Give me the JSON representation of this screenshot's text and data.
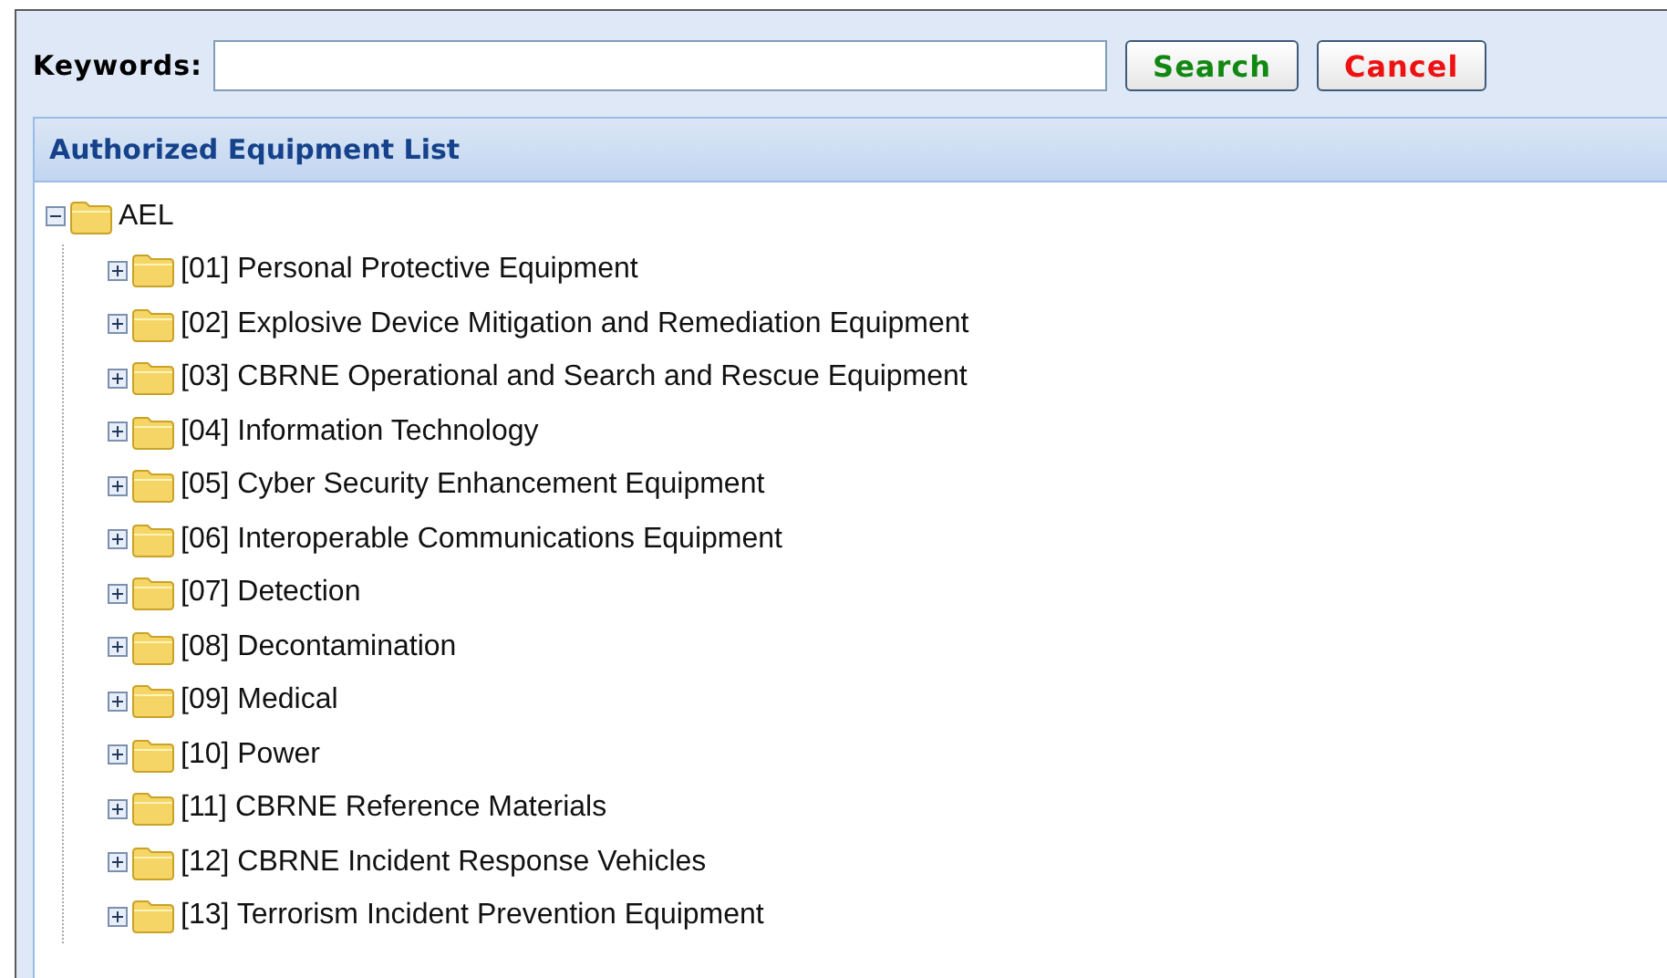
{
  "search": {
    "label": "Keywords:"
  },
  "buttons": [
    {
      "label": "Search",
      "kind": "search"
    },
    {
      "label": "Cancel",
      "kind": "cancel"
    }
  ],
  "panel": {
    "title": "Authorized Equipment List"
  },
  "tree": [
    {
      "label": "AEL",
      "expanded": true,
      "children": [
        {
          "label": "[01] Personal Protective Equipment",
          "expanded": false
        },
        {
          "label": "[02] Explosive Device Mitigation and Remediation Equipment",
          "expanded": false
        },
        {
          "label": "[03] CBRNE Operational and Search and Rescue Equipment",
          "expanded": false
        },
        {
          "label": "[04] Information Technology",
          "expanded": false
        },
        {
          "label": "[05] Cyber Security Enhancement Equipment",
          "expanded": false
        },
        {
          "label": "[06] Interoperable Communications Equipment",
          "expanded": false
        },
        {
          "label": "[07] Detection",
          "expanded": false
        },
        {
          "label": "[08] Decontamination",
          "expanded": false
        },
        {
          "label": "[09] Medical",
          "expanded": false
        },
        {
          "label": "[10] Power",
          "expanded": false
        },
        {
          "label": "[11] CBRNE Reference Materials",
          "expanded": false
        },
        {
          "label": "[12] CBRNE Incident Response Vehicles",
          "expanded": false
        },
        {
          "label": "[13] Terrorism Incident Prevention Equipment",
          "expanded": false
        }
      ]
    }
  ]
}
